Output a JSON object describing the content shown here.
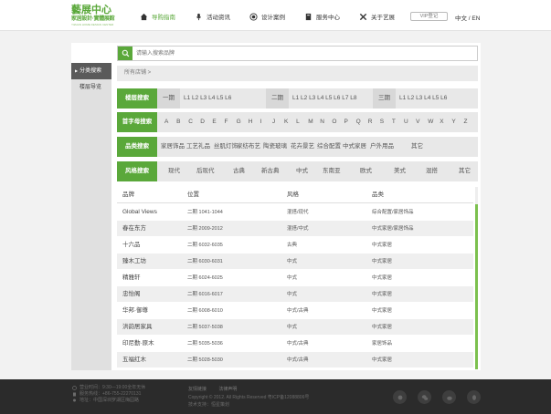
{
  "header": {
    "logo_line1": "藝展中心",
    "logo_line2": "家居設計·實體展館",
    "logo_line3": "YIZHAN HOME DESIGN CENTER",
    "nav": [
      {
        "label": "导购指南",
        "icon": "home-icon",
        "active": true
      },
      {
        "label": "活动资讯",
        "icon": "microphone-icon",
        "active": false
      },
      {
        "label": "设计案例",
        "icon": "target-icon",
        "active": false
      },
      {
        "label": "服务中心",
        "icon": "book-icon",
        "active": false
      },
      {
        "label": "关于艺展",
        "icon": "tools-icon",
        "active": false
      }
    ],
    "vip_label": "VIP登记",
    "lang_label": "中文 / EN"
  },
  "sidebar": {
    "items": [
      {
        "label": "分类搜索",
        "active": true
      },
      {
        "label": "楼层导览",
        "active": false
      }
    ]
  },
  "search": {
    "placeholder": "请输入搜索品牌"
  },
  "breadcrumb": "所有店铺 >",
  "filters": {
    "floor": {
      "tag": "楼层搜索",
      "phases": [
        {
          "name": "一期",
          "levels": "L1 L2 L3 L4 L5 L6"
        },
        {
          "name": "二期",
          "levels": "L1 L2 L3 L4 L5 L6 L7 L8"
        },
        {
          "name": "三期",
          "levels": "L1 L2 L3 L4 L5 L6"
        }
      ]
    },
    "letter": {
      "tag": "首字母搜索",
      "items": [
        "A",
        "B",
        "C",
        "D",
        "E",
        "F",
        "G",
        "H",
        "I",
        "J",
        "K",
        "L",
        "M",
        "N",
        "O",
        "P",
        "Q",
        "R",
        "S",
        "T",
        "U",
        "V",
        "W",
        "X",
        "Y",
        "Z"
      ]
    },
    "category": {
      "tag": "品类搜索",
      "items": [
        "家居饰品",
        "工艺礼品",
        "丝肌灯饰",
        "家纺布艺",
        "陶瓷玻璃",
        "花卉景艺",
        "综合配置",
        "中式家居",
        "户外用品",
        "其它"
      ]
    },
    "style": {
      "tag": "风格搜索",
      "items": [
        "现代",
        "后现代",
        "古典",
        "新古典",
        "中式",
        "东南亚",
        "欧式",
        "美式",
        "混搭",
        "其它"
      ]
    }
  },
  "table": {
    "headers": [
      "品牌",
      "位置",
      "风格",
      "品类"
    ],
    "rows": [
      [
        "Global Views",
        "二期 1041-1044",
        "混搭/现代",
        "综合配置/家居饰品"
      ],
      [
        "春在东方",
        "二期 2009-2012",
        "混搭/中式",
        "中式家居/家居饰品"
      ],
      [
        "十六品",
        "二期 6032-6035",
        "古典",
        "中式家居"
      ],
      [
        "臻木工坊",
        "二期 6030-6031",
        "中式",
        "中式家居"
      ],
      [
        "精雅轩",
        "二期 6024-6025",
        "中式",
        "中式家居"
      ],
      [
        "忠怡阁",
        "二期 6016-6017",
        "中式",
        "中式家居"
      ],
      [
        "华邦·御尊",
        "二期 6008-6010",
        "中式/古典",
        "中式家居"
      ],
      [
        "洪韵居家具",
        "二期 5037-5038",
        "中式",
        "中式家居"
      ],
      [
        "印尼勤·原木",
        "二期 5035-5036",
        "中式/古典",
        "家居饰品"
      ],
      [
        "五福红木",
        "二期 5028-5030",
        "中式/古典",
        "中式家居"
      ]
    ]
  },
  "footer": {
    "info": [
      {
        "icon": "clock-icon",
        "text": "营业时间：9:30—19:00全年无休"
      },
      {
        "icon": "phone-icon",
        "text": "服务热线：+86-755-22270131"
      },
      {
        "icon": "location-icon",
        "text": "地址：中国深圳罗湖区梅园路"
      }
    ],
    "links": [
      "友情链接",
      "法律声明"
    ],
    "copyright": "Copyright © 2012. All Rights Reserved 粤ICP备12088806号",
    "support": "技术支持：恒星策划",
    "social": [
      "wechat-icon",
      "chat-icon",
      "weibo-icon",
      "qq-icon"
    ]
  },
  "colors": {
    "accent": "#5aa83a",
    "footer_bg": "#2b2b2b"
  }
}
